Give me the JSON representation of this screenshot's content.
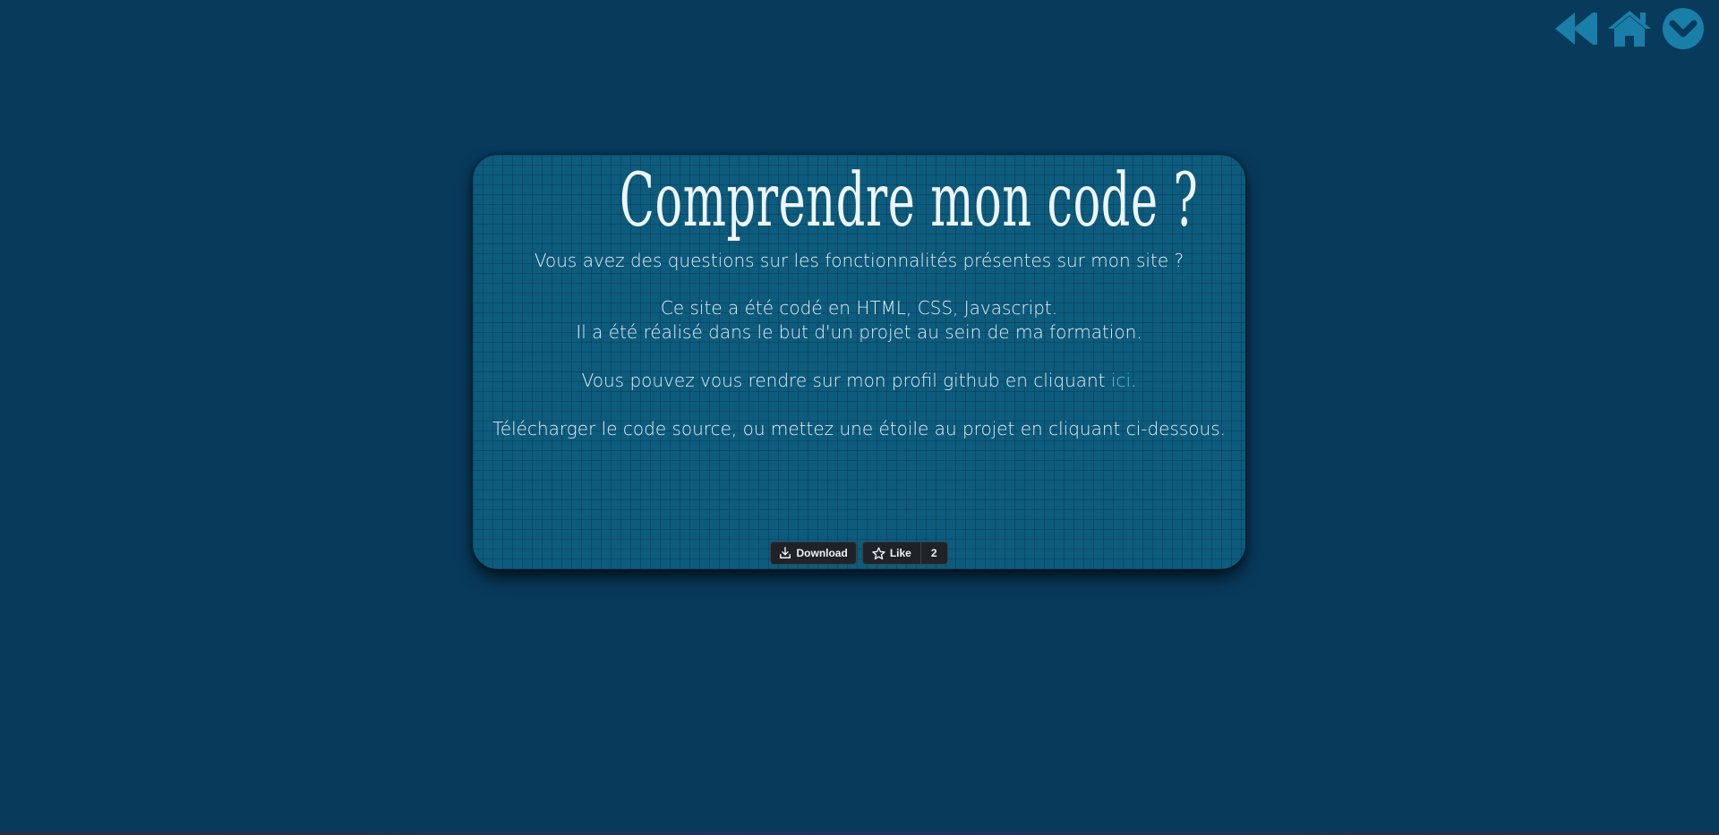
{
  "nav": {
    "icons": [
      "rewind-icon",
      "home-icon",
      "chevron-down-circle-icon"
    ],
    "color": "#1a7fa8"
  },
  "card": {
    "title": "Comprendre mon code ?",
    "question": "Vous avez des questions sur les fonctionnalités présentes sur mon site ?",
    "info_line1": "Ce site a été codé en HTML, CSS, Javascript.",
    "info_line2": "Il a été réalisé dans le but d'un projet au sein de ma formation.",
    "github_text": "Vous pouvez vous rendre sur mon profil github en cliquant",
    "github_link": "ici",
    "github_period": ".",
    "download_text": "Télécharger le code source, ou mettez une étoile au projet en cliquant ci-dessous."
  },
  "buttons": {
    "download_label": "Download",
    "like_label": "Like",
    "like_count": "2"
  },
  "colors": {
    "background": "#083a5c",
    "card": "#0d5b7d",
    "link": "#5fc0da",
    "button": "#1f2328"
  }
}
